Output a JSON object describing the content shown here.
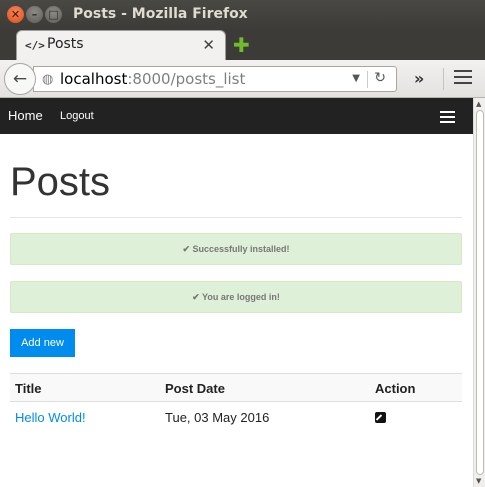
{
  "window": {
    "title": "Posts - Mozilla Firefox",
    "close_glyph": "✕",
    "minimize_glyph": "–",
    "maximize_glyph": "□"
  },
  "tab": {
    "icon_glyph": "</>",
    "label": "Posts",
    "close_glyph": "✕",
    "new_tab_glyph": "✚"
  },
  "navbar": {
    "back_glyph": "←",
    "url_host": "localhost",
    "url_rest": ":8000/posts_list",
    "dropdown_glyph": "▼",
    "reload_glyph": "↻",
    "overflow_glyph": "»"
  },
  "site_nav": {
    "home_label": "Home",
    "logout_label": "Logout"
  },
  "page": {
    "title": "Posts",
    "alerts": [
      {
        "text": "✔ Successfully installed!"
      },
      {
        "text": "✔ You are logged in!"
      }
    ],
    "add_button_label": "Add new"
  },
  "table": {
    "headers": [
      "Title",
      "Post Date",
      "Action"
    ],
    "rows": [
      {
        "title": "Hello World!",
        "post_date": "Tue, 03 May 2016"
      }
    ]
  },
  "colors": {
    "accent": "#008cee",
    "site_nav_bg": "#222222",
    "alert_bg": "#dff0d8"
  },
  "icons": {
    "edit": "edit-icon",
    "globe": "globe-icon",
    "hamburger": "hamburger-icon"
  }
}
